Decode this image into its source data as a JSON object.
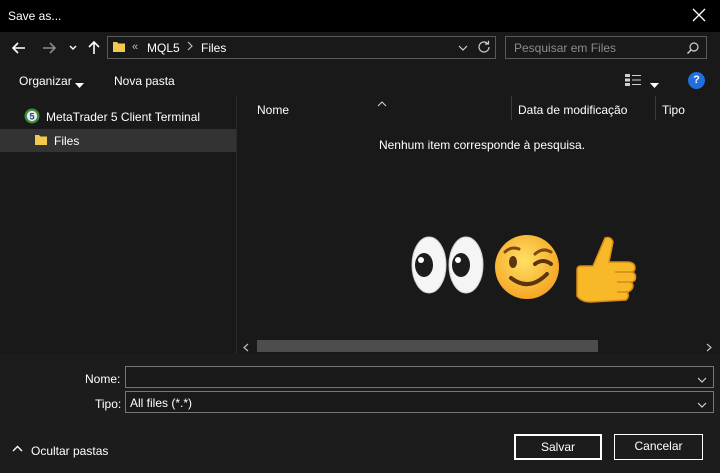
{
  "window": {
    "title": "Save as..."
  },
  "address": {
    "overflow": "«",
    "crumbs": [
      "MQL5",
      "Files"
    ]
  },
  "search": {
    "placeholder": "Pesquisar em Files"
  },
  "toolbar": {
    "organize_label": "Organizar",
    "new_folder_label": "Nova pasta"
  },
  "nav": {
    "items": [
      {
        "label": "MetaTrader 5 Client Terminal",
        "icon": "mt5-icon"
      },
      {
        "label": "Files",
        "icon": "folder-icon",
        "selected": true
      }
    ]
  },
  "columns": [
    "Nome",
    "Data de modificação",
    "Tipo"
  ],
  "empty_message": "Nenhum item corresponde à pesquisa.",
  "emojis": [
    "👀",
    "😉",
    "👍"
  ],
  "form": {
    "name_label": "Nome:",
    "name_value": "",
    "type_label": "Tipo:",
    "type_value": "All files (*.*)"
  },
  "footer": {
    "toggle_label": "Ocultar pastas",
    "save_label": "Salvar",
    "cancel_label": "Cancelar"
  },
  "colors": {
    "folder": "#f2c94c",
    "accent": "#1f6fe0",
    "background": "#191919"
  }
}
